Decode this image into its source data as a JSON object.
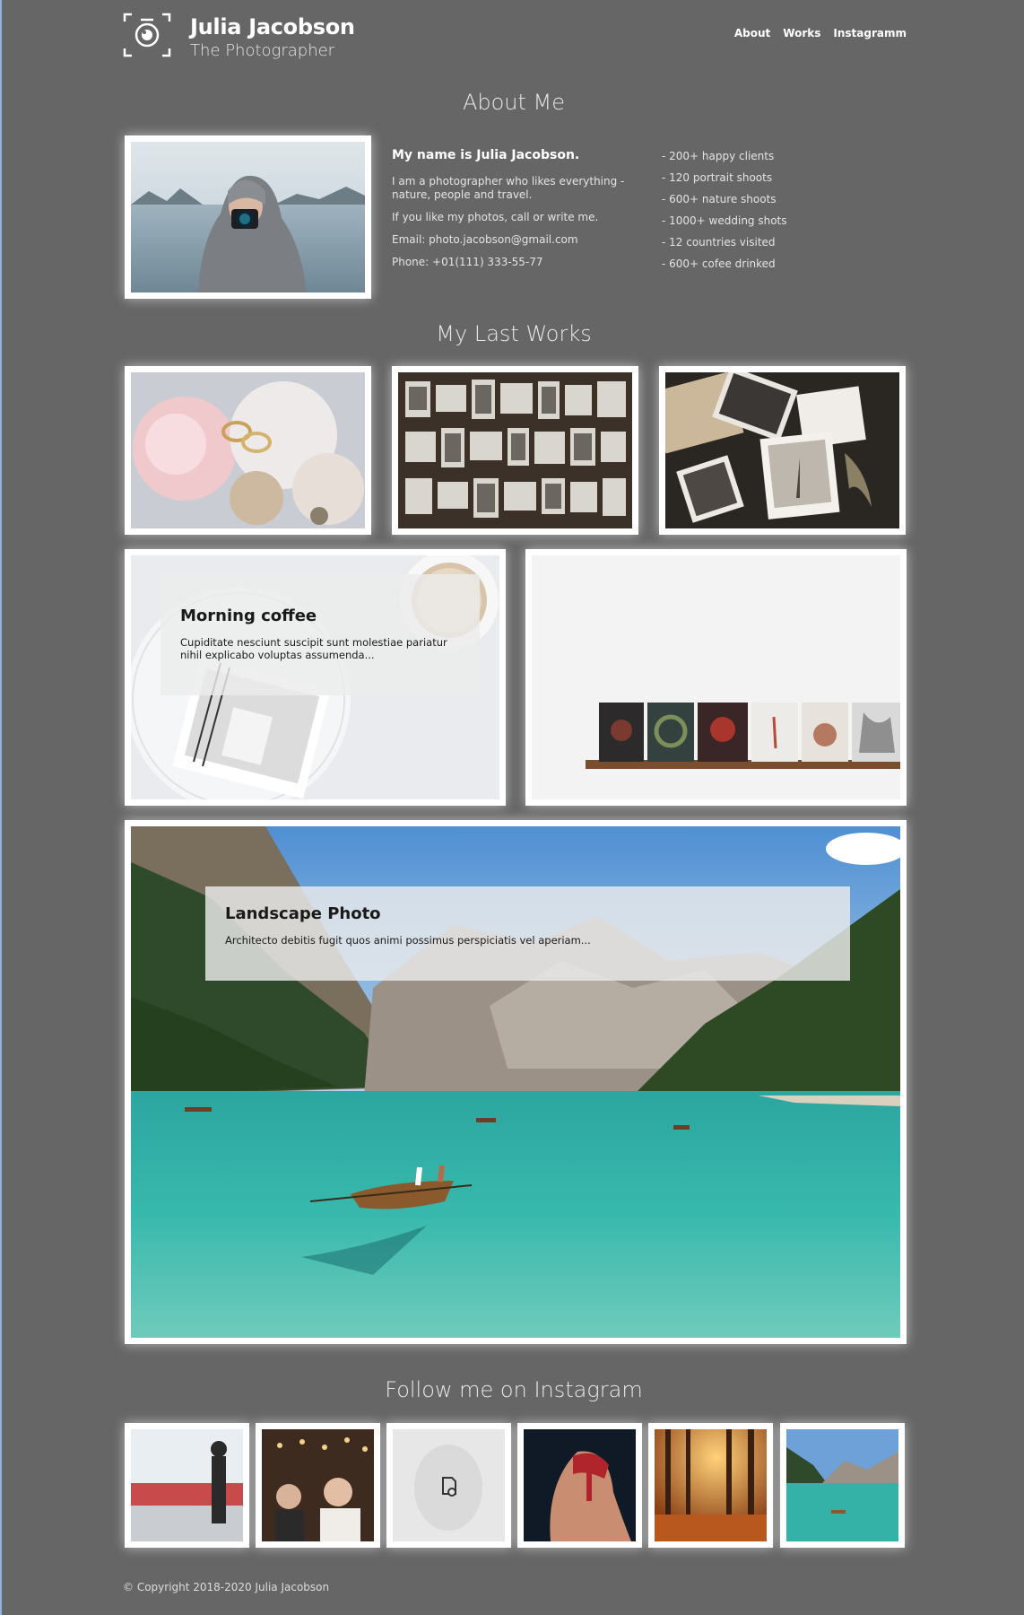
{
  "header": {
    "brand_name": "Julia Jacobson",
    "brand_subtitle": "The Photographer",
    "logo_icon": "camera-icon",
    "nav": [
      {
        "label": "About"
      },
      {
        "label": "Works"
      },
      {
        "label": "Instagramm"
      }
    ]
  },
  "about": {
    "title": "About Me",
    "name_line": "My name is Julia Jacobson.",
    "intro": "I am a photographer who likes everything - nature, people and travel.",
    "contact_line": "If you like my photos, call or write me.",
    "email": "Email: photo.jacobson@gmail.com",
    "phone": "Phone: +01(111) 333-55-77",
    "stats": [
      "- 200+ happy clients",
      "- 120 portrait shoots",
      "- 600+ nature shoots",
      "- 1000+ wedding shots",
      "- 12 countries visited",
      "- 600+ cofee drinked"
    ]
  },
  "works": {
    "title": "My Last Works",
    "cards": [
      {
        "title": "Morning coffee",
        "text": "Cupiditate nesciunt suscipit sunt molestiae pariatur nihil explicabo voluptas assumenda..."
      },
      {
        "title": "Landscape Photo",
        "text": "Architecto debitis fugit quos animi possimus perspiciatis vel aperiam..."
      }
    ]
  },
  "instagram": {
    "title": "Follow me on Instagram"
  },
  "footer": {
    "copyright": "© Copyright 2018-2020 Julia Jacobson"
  },
  "colors": {
    "background": "#666666",
    "frame": "#ffffff",
    "lake": "#2fb3a8"
  }
}
